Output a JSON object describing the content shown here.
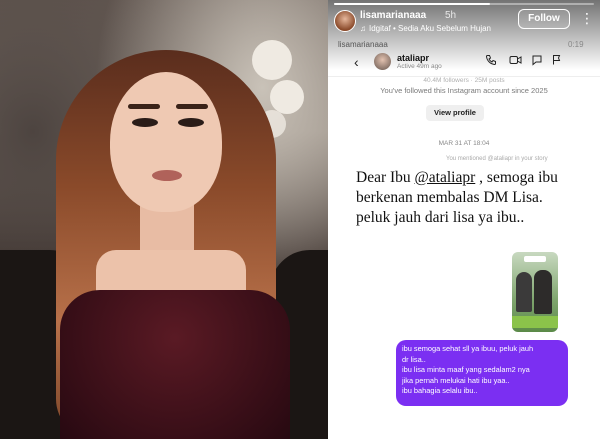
{
  "story": {
    "progress": 0.6,
    "username": "lisamarianaaa",
    "time_ago": "5h",
    "music": "Idgitaf • Sedia Aku Sebelum Hujan",
    "follow_label": "Follow",
    "more_icon": "more-vertical-icon",
    "watermark": "lisamarianaaa",
    "clock": "0:19"
  },
  "dm": {
    "contact_name": "ataliapr",
    "contact_status": "Active 49m ago",
    "icons": [
      "back-icon",
      "phone-icon",
      "video-icon",
      "tag-icon",
      "flag-icon"
    ],
    "followers_line": "40.4M followers · 25M posts",
    "followed_line": "You've followed this Instagram account since 2025",
    "view_profile_label": "View profile",
    "date_stamp": "MAR 31 AT 18:04",
    "mention_note": "You mentioned @ataliapr in your story",
    "message_prefix": "Dear Ibu ",
    "message_handle": "@ataliapr",
    "message_suffix": " , semoga ibu berkenan membalas DM Lisa. peluk jauh dari lisa ya ibu..",
    "bubble_lines": [
      "ibu semoga sehat sll ya ibuu, peluk jauh",
      "dr lisa..",
      "ibu lisa minta maaf yang sedalam2 nya",
      "jika pernah melukai hati ibu yaa..",
      "ibu bahagia selalu ibu.."
    ],
    "accent_color": "#7b2ff2"
  }
}
